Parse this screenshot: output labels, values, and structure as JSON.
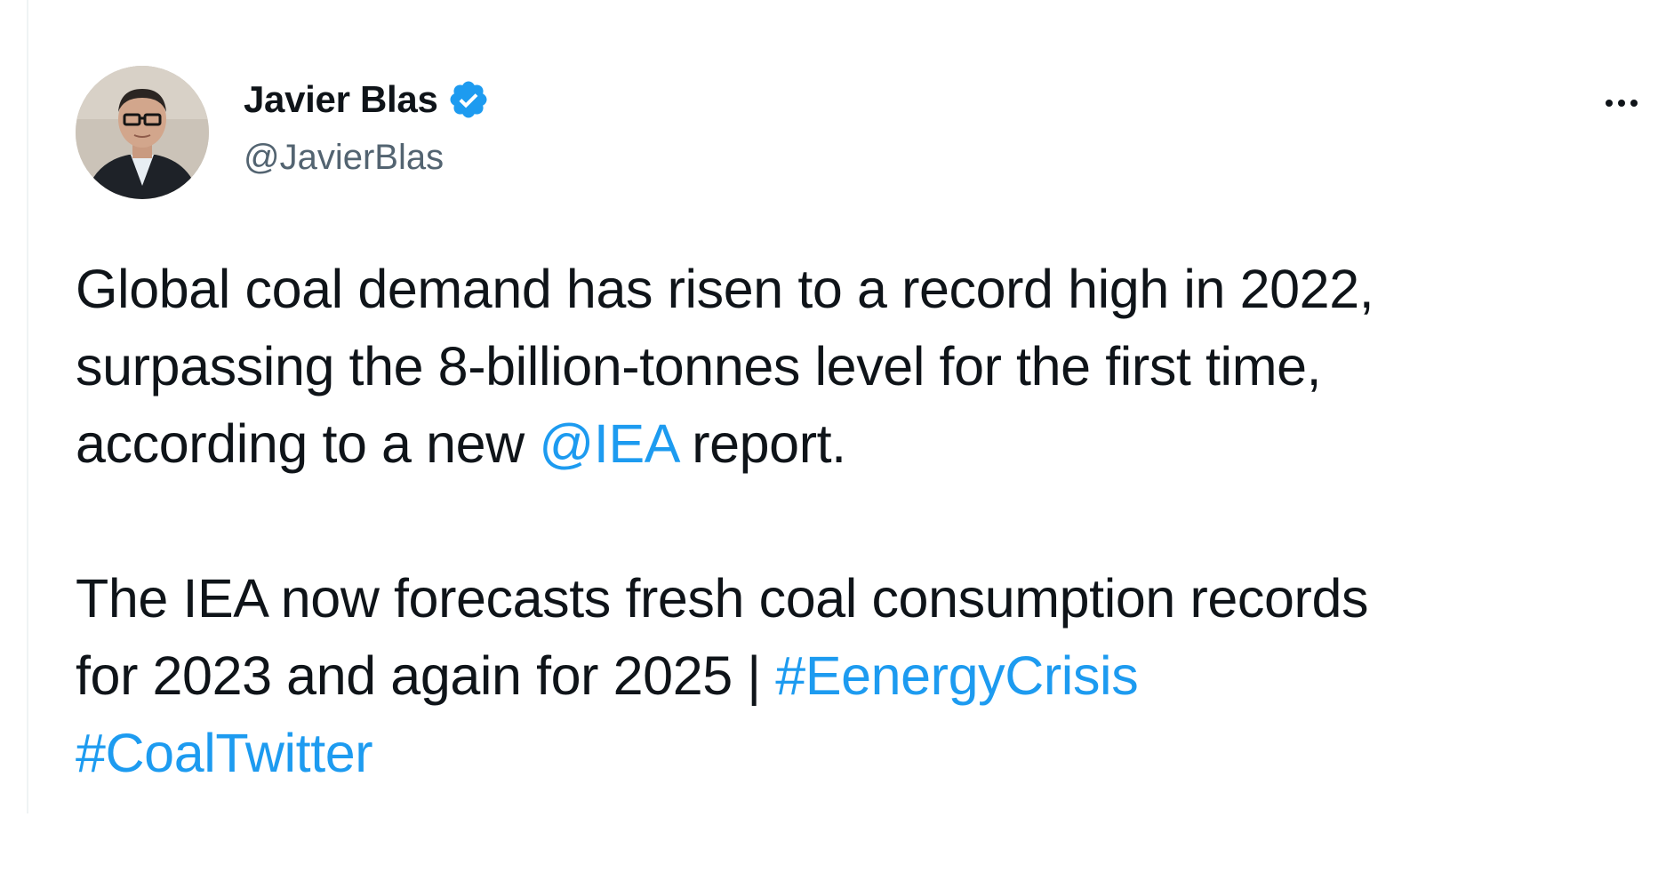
{
  "author": {
    "display_name": "Javier Blas",
    "handle": "@JavierBlas",
    "verified_icon": "verified-badge-icon",
    "verified_color": "#1d9bf0"
  },
  "menu": {
    "more_icon": "more-options-icon"
  },
  "tweet": {
    "line1": "Global coal demand has risen to a record high in 2022,",
    "line2": "surpassing the 8-billion-tonnes level for the first time,",
    "line3_prefix": "according to a new ",
    "mention": "@IEA",
    "line3_suffix": " report.",
    "line4": "The IEA now forecasts fresh coal consumption records",
    "line5_prefix": "for 2023 and again for 2025 | ",
    "hashtag1": "#EenergyCrisis",
    "hashtag2": "#CoalTwitter"
  },
  "colors": {
    "text": "#0f1419",
    "secondary": "#536471",
    "link": "#1d9bf0"
  }
}
